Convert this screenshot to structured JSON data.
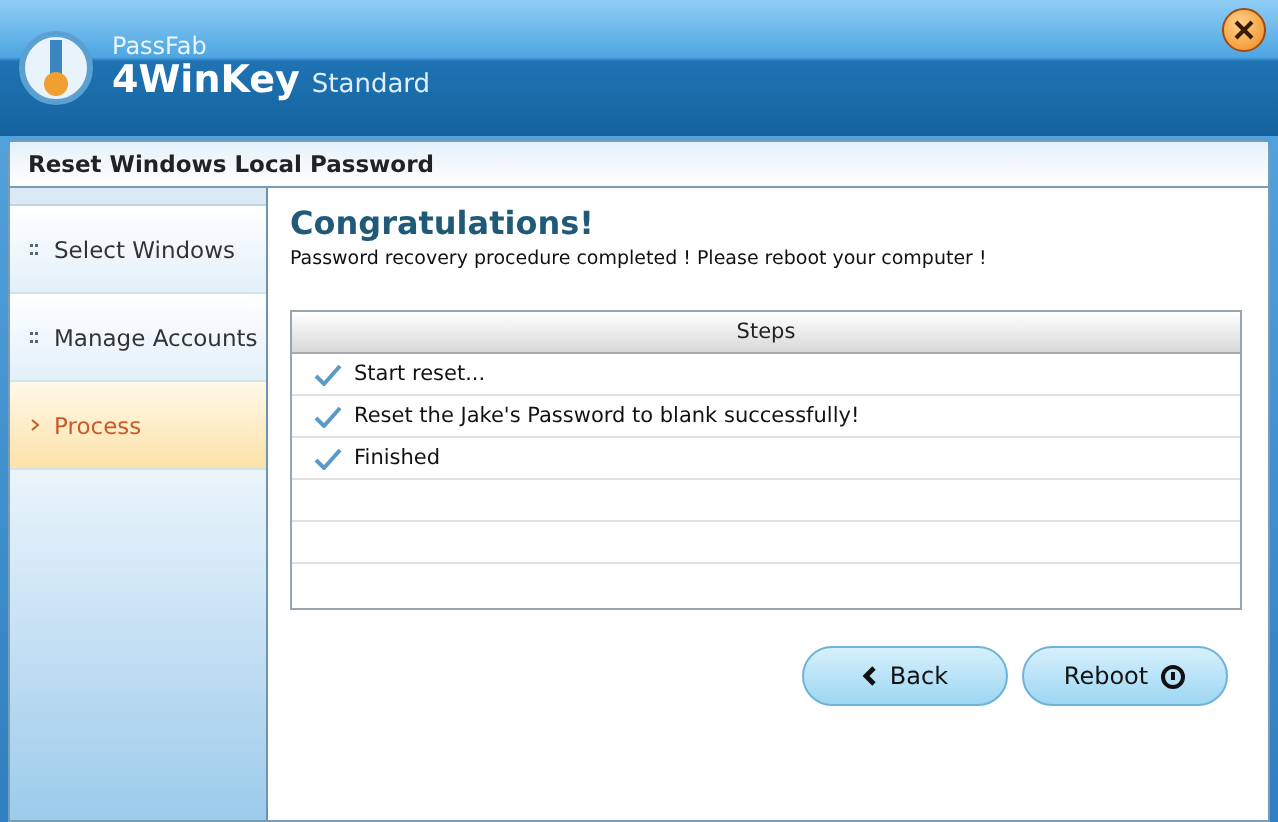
{
  "header": {
    "brand": "PassFab",
    "product": "4WinKey",
    "edition": "Standard"
  },
  "panel": {
    "title": "Reset Windows Local Password"
  },
  "sidebar": {
    "items": [
      {
        "label": "Select Windows",
        "selected": false
      },
      {
        "label": "Manage Accounts",
        "selected": false
      },
      {
        "label": "Process",
        "selected": true
      }
    ]
  },
  "main": {
    "heading": "Congratulations!",
    "message": "Password recovery procedure completed ! Please reboot your computer !",
    "steps": {
      "header": "Steps",
      "rows": [
        {
          "text": "Start reset...",
          "done": true
        },
        {
          "text": "Reset the Jake's Password to blank successfully!",
          "done": true
        },
        {
          "text": "Finished",
          "done": true
        }
      ]
    }
  },
  "buttons": [
    {
      "label": "Back",
      "kind": "back"
    },
    {
      "label": "Reboot",
      "kind": "reboot"
    }
  ]
}
